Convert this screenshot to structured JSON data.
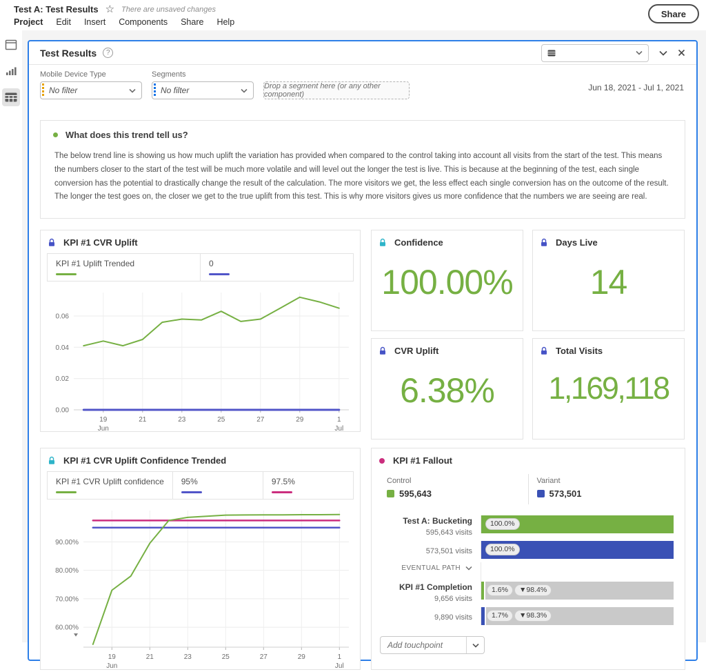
{
  "app": {
    "title": "Test A: Test Results",
    "unsaved_notice": "There are unsaved changes",
    "menu": [
      "Project",
      "Edit",
      "Insert",
      "Components",
      "Share",
      "Help"
    ],
    "share_button": "Share"
  },
  "icons": {
    "star": "☆",
    "help": "?"
  },
  "sidebar": {
    "items": [
      "panels-icon",
      "visualizations-icon",
      "freeform-table-icon"
    ],
    "selected": "freeform-table-icon"
  },
  "panel": {
    "title": "Test Results",
    "date_range": "Jun 18, 2021 - Jul 1, 2021",
    "filters": {
      "device_label": "Mobile Device Type",
      "device_value": "No filter",
      "segments_label": "Segments",
      "segments_value": "No filter",
      "dropzone_text": "Drop a segment here (or any other component)"
    }
  },
  "trend_note": {
    "heading": "What does this trend tell us?",
    "body": "The below trend line is showing us how much uplift the variation has provided when compared to the control taking into account all visits from the start of the test. This means the numbers closer to the start of the test will be much more volatile and will level out the longer the test is live. This is because at the beginning of the test, each single conversion has the potential to drastically change the result of the calculation. The more visitors we get, the less effect each single conversion has on the outcome of the result. The longer the test goes on, the closer we get to the true uplift from this test. This is why more visitors gives us more confidence that the numbers we are seeing are real."
  },
  "uplift_chart": {
    "title": "KPI #1 CVR Uplift",
    "legend": [
      {
        "label": "KPI #1 Uplift Trended"
      },
      {
        "label": "0"
      }
    ]
  },
  "confidence_chart": {
    "title": "KPI #1 CVR Uplift Confidence Trended",
    "legend": [
      {
        "label": "KPI #1 CVR Uplift confidence"
      },
      {
        "label": "95%"
      },
      {
        "label": "97.5%"
      }
    ]
  },
  "cards": {
    "confidence": {
      "title": "Confidence",
      "value": "100.00%"
    },
    "days_live": {
      "title": "Days Live",
      "value": "14"
    },
    "cvr_uplift": {
      "title": "CVR Uplift",
      "value": "6.38%"
    },
    "total_visits": {
      "title": "Total Visits",
      "value": "1,169,118"
    }
  },
  "fallout": {
    "title": "KPI #1 Fallout",
    "control_label": "Control",
    "control_total": "595,643",
    "variant_label": "Variant",
    "variant_total": "573,501",
    "steps": [
      {
        "label": "Test A: Bucketing",
        "control_visits": "595,643 visits",
        "control_pct": "100.0%",
        "control_width": 100,
        "variant_visits": "573,501 visits",
        "variant_pct": "100.0%",
        "variant_width": 100
      },
      {
        "label": "KPI #1 Completion",
        "control_visits": "9,656 visits",
        "control_pct": "1.6%",
        "control_drop": "▼98.4%",
        "control_width": 1.6,
        "variant_visits": "9,890 visits",
        "variant_pct": "1.7%",
        "variant_drop": "▼98.3%",
        "variant_width": 1.7
      }
    ],
    "eventual_path": "EVENTUAL PATH",
    "add_touchpoint": "Add touchpoint"
  },
  "colors": {
    "accent_green": "#76B043",
    "indigo_line": "#5155C8",
    "variant_blue": "#3A51B5",
    "magenta": "#CB2E7E",
    "teal_lock": "#2EB4C9",
    "blue_lock": "#4653C6",
    "panel_border": "#2D7FE8",
    "dimension_orange": "#E8A200",
    "segment_blue": "#1473E6",
    "fallout_gray": "#C9C9C9"
  },
  "chart_data": [
    {
      "type": "line",
      "title": "KPI #1 CVR Uplift",
      "x": [
        "Jun 18",
        "Jun 19",
        "Jun 20",
        "Jun 21",
        "Jun 22",
        "Jun 23",
        "Jun 24",
        "Jun 25",
        "Jun 26",
        "Jun 27",
        "Jun 28",
        "Jun 29",
        "Jun 30",
        "Jul 1"
      ],
      "series": [
        {
          "name": "0",
          "color": "#5155C8",
          "const": 0,
          "width": 3
        },
        {
          "name": "KPI #1 Uplift Trended",
          "color": "#76B043",
          "width": 2,
          "values": [
            0.041,
            0.044,
            0.041,
            0.045,
            0.056,
            0.058,
            0.0575,
            0.063,
            0.0565,
            0.058,
            0.065,
            0.072,
            0.069,
            0.065
          ]
        }
      ],
      "ylim": [
        0,
        0.075
      ],
      "yticks": [
        {
          "v": 0,
          "label": "0.00"
        },
        {
          "v": 0.02,
          "label": "0.02"
        },
        {
          "v": 0.04,
          "label": "0.04"
        },
        {
          "v": 0.06,
          "label": "0.06"
        }
      ],
      "xticks": [
        {
          "i": 1,
          "label": "19",
          "sub": "Jun"
        },
        {
          "i": 3,
          "label": "21"
        },
        {
          "i": 5,
          "label": "23"
        },
        {
          "i": 7,
          "label": "25"
        },
        {
          "i": 9,
          "label": "27"
        },
        {
          "i": 11,
          "label": "29"
        },
        {
          "i": 13,
          "label": "1",
          "sub": "Jul"
        }
      ],
      "grid": true,
      "legend_position": "top"
    },
    {
      "type": "line",
      "title": "KPI #1 CVR Uplift Confidence Trended",
      "x": [
        "Jun 18",
        "Jun 19",
        "Jun 20",
        "Jun 21",
        "Jun 22",
        "Jun 23",
        "Jun 24",
        "Jun 25",
        "Jun 26",
        "Jun 27",
        "Jun 28",
        "Jun 29",
        "Jun 30",
        "Jul 1"
      ],
      "series": [
        {
          "name": "95%",
          "color": "#5155C8",
          "const": 95,
          "width": 2.5
        },
        {
          "name": "97.5%",
          "color": "#CB2E7E",
          "const": 97.5,
          "width": 2.5
        },
        {
          "name": "KPI #1 CVR Uplift confidence",
          "color": "#76B043",
          "width": 2,
          "values": [
            54,
            73,
            78,
            89.5,
            97.5,
            98.6,
            99.0,
            99.4,
            99.45,
            99.5,
            99.5,
            99.55,
            99.55,
            99.6
          ]
        }
      ],
      "ylim": [
        53,
        101
      ],
      "yticks": [
        {
          "v": 60,
          "label": "60.00%"
        },
        {
          "v": 70,
          "label": "70.00%"
        },
        {
          "v": 80,
          "label": "80.00%"
        },
        {
          "v": 90,
          "label": "90.00%"
        }
      ],
      "xticks": [
        {
          "i": 1,
          "label": "19",
          "sub": "Jun"
        },
        {
          "i": 3,
          "label": "21"
        },
        {
          "i": 5,
          "label": "23"
        },
        {
          "i": 7,
          "label": "25"
        },
        {
          "i": 9,
          "label": "27"
        },
        {
          "i": 11,
          "label": "29"
        },
        {
          "i": 13,
          "label": "1",
          "sub": "Jul"
        }
      ],
      "truncated": true,
      "grid": true,
      "legend_position": "top"
    },
    {
      "type": "funnel",
      "title": "KPI #1 Fallout",
      "series": [
        {
          "name": "Control",
          "total": 595643
        },
        {
          "name": "Variant",
          "total": 573501
        }
      ],
      "steps": [
        {
          "label": "Test A: Bucketing",
          "control": {
            "visits": 595643,
            "pct": 100.0
          },
          "variant": {
            "visits": 573501,
            "pct": 100.0
          }
        },
        {
          "label": "KPI #1 Completion",
          "control": {
            "visits": 9656,
            "pct": 1.6,
            "fallout_pct": 98.4
          },
          "variant": {
            "visits": 9890,
            "pct": 1.7,
            "fallout_pct": 98.3
          }
        }
      ]
    }
  ]
}
